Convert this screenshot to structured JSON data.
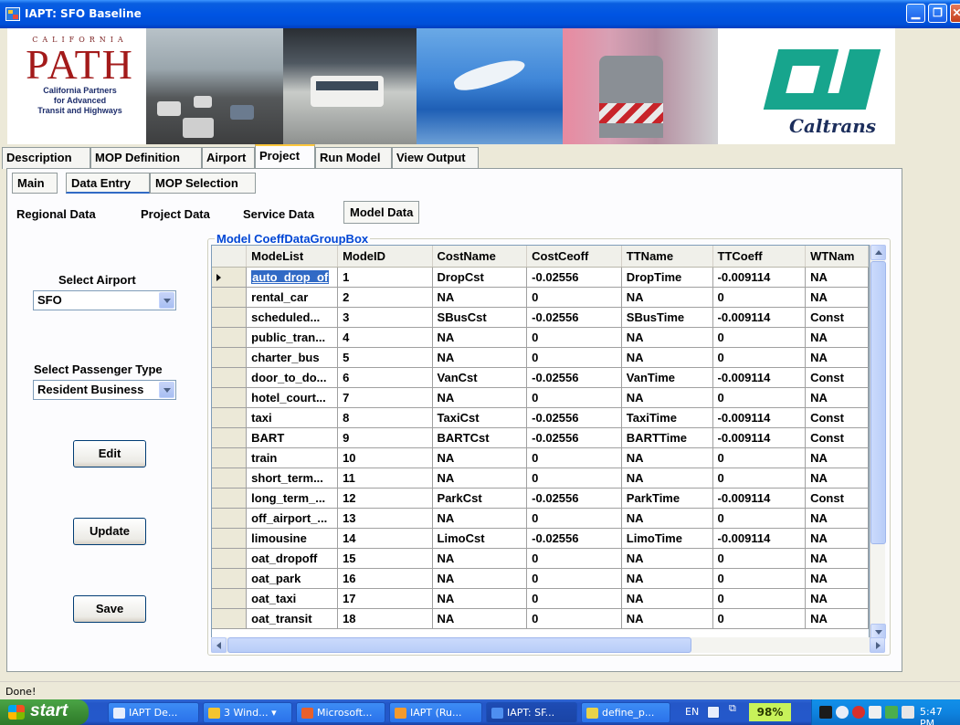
{
  "window": {
    "title": "IAPT: SFO Baseline"
  },
  "banner": {
    "path_logo": {
      "top": "CALIFORNIA",
      "main": "PATH",
      "sub": [
        "California Partners",
        "for Advanced",
        "Transit and Highways"
      ]
    },
    "caltrans_logo": "Caltrans"
  },
  "main_tabs": [
    "Description",
    "MOP Definition",
    "Airport",
    "Project",
    "Run Model",
    "View Output"
  ],
  "main_tab_active": "Project",
  "sub_tabs": [
    "Main",
    "Data Entry",
    "MOP Selection"
  ],
  "sub_tab_active": "Data Entry",
  "data_tabs": [
    "Regional Data",
    "Project Data",
    "Service Data",
    "Model Data"
  ],
  "data_tab_active": "Model Data",
  "left": {
    "airport_label": "Select Airport",
    "airport_value": "SFO",
    "passenger_label": "Select Passenger Type",
    "passenger_value": "Resident Business",
    "edit_button": "Edit",
    "update_button": "Update",
    "save_button": "Save"
  },
  "grid": {
    "group_title": "Model CoeffDataGroupBox",
    "columns": [
      "ModeList",
      "ModeID",
      "CostName",
      "CostCeoff",
      "TTName",
      "TTCoeff",
      "WTNam"
    ],
    "rows": [
      [
        "auto_drop_off",
        "1",
        "DropCst",
        "-0.02556",
        "DropTime",
        "-0.009114",
        "NA"
      ],
      [
        "rental_car",
        "2",
        "NA",
        "0",
        "NA",
        "0",
        "NA"
      ],
      [
        "scheduled...",
        "3",
        "SBusCst",
        "-0.02556",
        "SBusTime",
        "-0.009114",
        "Const"
      ],
      [
        "public_tran...",
        "4",
        "NA",
        "0",
        "NA",
        "0",
        "NA"
      ],
      [
        "charter_bus",
        "5",
        "NA",
        "0",
        "NA",
        "0",
        "NA"
      ],
      [
        "door_to_do...",
        "6",
        "VanCst",
        "-0.02556",
        "VanTime",
        "-0.009114",
        "Const"
      ],
      [
        "hotel_court...",
        "7",
        "NA",
        "0",
        "NA",
        "0",
        "NA"
      ],
      [
        "taxi",
        "8",
        "TaxiCst",
        "-0.02556",
        "TaxiTime",
        "-0.009114",
        "Const"
      ],
      [
        "BART",
        "9",
        "BARTCst",
        "-0.02556",
        "BARTTime",
        "-0.009114",
        "Const"
      ],
      [
        "train",
        "10",
        "NA",
        "0",
        "NA",
        "0",
        "NA"
      ],
      [
        "short_term...",
        "11",
        "NA",
        "0",
        "NA",
        "0",
        "NA"
      ],
      [
        "long_term_...",
        "12",
        "ParkCst",
        "-0.02556",
        "ParkTime",
        "-0.009114",
        "Const"
      ],
      [
        "off_airport_...",
        "13",
        "NA",
        "0",
        "NA",
        "0",
        "NA"
      ],
      [
        "limousine",
        "14",
        "LimoCst",
        "-0.02556",
        "LimoTime",
        "-0.009114",
        "NA"
      ],
      [
        "oat_dropoff",
        "15",
        "NA",
        "0",
        "NA",
        "0",
        "NA"
      ],
      [
        "oat_park",
        "16",
        "NA",
        "0",
        "NA",
        "0",
        "NA"
      ],
      [
        "oat_taxi",
        "17",
        "NA",
        "0",
        "NA",
        "0",
        "NA"
      ],
      [
        "oat_transit",
        "18",
        "NA",
        "0",
        "NA",
        "0",
        "NA"
      ]
    ],
    "selected_row": 0,
    "selected_cell_text": "auto_drop_of"
  },
  "status_text": "Done!",
  "taskbar": {
    "start_label": "start",
    "tasks": [
      "IAPT De...",
      "3 Wind...",
      "Microsoft...",
      "IAPT (Ru...",
      "IAPT: SF...",
      "define_p..."
    ],
    "active_task": "IAPT: SF...",
    "language": "EN",
    "battery": "98%",
    "clock": "5:47 PM"
  },
  "colors": {
    "titlebar": "#0054e3",
    "selection": "#316ac5",
    "group_title": "#0046d5",
    "tab_highlight": "#ffc73c"
  }
}
